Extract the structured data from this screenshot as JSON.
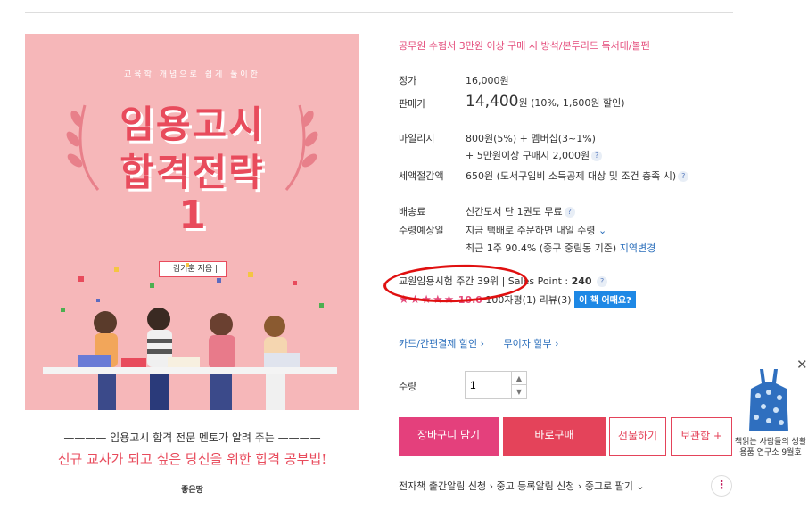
{
  "cover": {
    "subtitle": "교육학 개념으로 쉽게 풀이한",
    "title_line1": "임용고시",
    "title_line2": "합격전략",
    "number": "1",
    "author": "| 김기훈 지음 |",
    "tagline1": "———— 임용고시 합격 전문 멘토가 알려 주는 ————",
    "tagline2": "신규 교사가 되고 싶은 당신을 위한 합격 공부법!",
    "publisher": "좋은땅"
  },
  "promo": "공무원 수험서 3만원 이상 구매 시 방석/본투리드 독서대/볼펜",
  "price": {
    "list_label": "정가",
    "list_value": "16,000원",
    "sale_label": "판매가",
    "sale_value": "14,400",
    "sale_unit": "원",
    "sale_detail": "(10%, 1,600원 할인)"
  },
  "mileage": {
    "label": "마일리지",
    "line1": "800원(5%) + 멤버십(3~1%)",
    "line2": "+ 5만원이상 구매시 2,000원"
  },
  "tax": {
    "label": "세액절감액",
    "value": "650원 (도서구입비 소득공제 대상 및 조건 충족 시)"
  },
  "shipping": {
    "label": "배송료",
    "value": "신간도서 단 1권도 무료"
  },
  "delivery": {
    "label": "수령예상일",
    "line1": "지금 택배로 주문하면 내일 수령",
    "line2": "최근 1주 90.4% (중구 중림동 기준)",
    "change_link": "지역변경"
  },
  "ranking": {
    "rank_text": "교원임용시험 주간 39위",
    "separator": "|",
    "sales_point": "Sales Point :",
    "sales_value": "240"
  },
  "review": {
    "stars": "★★★★★",
    "score": "10.0",
    "count_100": "100자평(1)",
    "review_count": "리뷰(3)",
    "badge": "이 책 어때요?"
  },
  "links": {
    "card": "카드/간편결제 할인 ›",
    "installment": "무이자 할부 ›"
  },
  "quantity": {
    "label": "수량",
    "value": "1"
  },
  "buttons": {
    "cart": "장바구니 담기",
    "buy": "바로구매",
    "gift": "선물하기",
    "save": "보관함 +"
  },
  "bottom_links": {
    "ebook": "전자책 출간알림 신청 ›",
    "used_alert": "중고 등록알림 신청 ›",
    "used_sell": "중고로 팔기 ⌄",
    "more": "⋮"
  },
  "ad": {
    "close": "✕",
    "text": "책읽는 사람들의 생활용품 연구소 9월호"
  },
  "colors": {
    "accent_pink": "#e4407c",
    "accent_red": "#e4435a",
    "cover_bg": "#f6b7b9",
    "link_blue": "#2a6ebb",
    "highlight_circle": "#e01010"
  }
}
